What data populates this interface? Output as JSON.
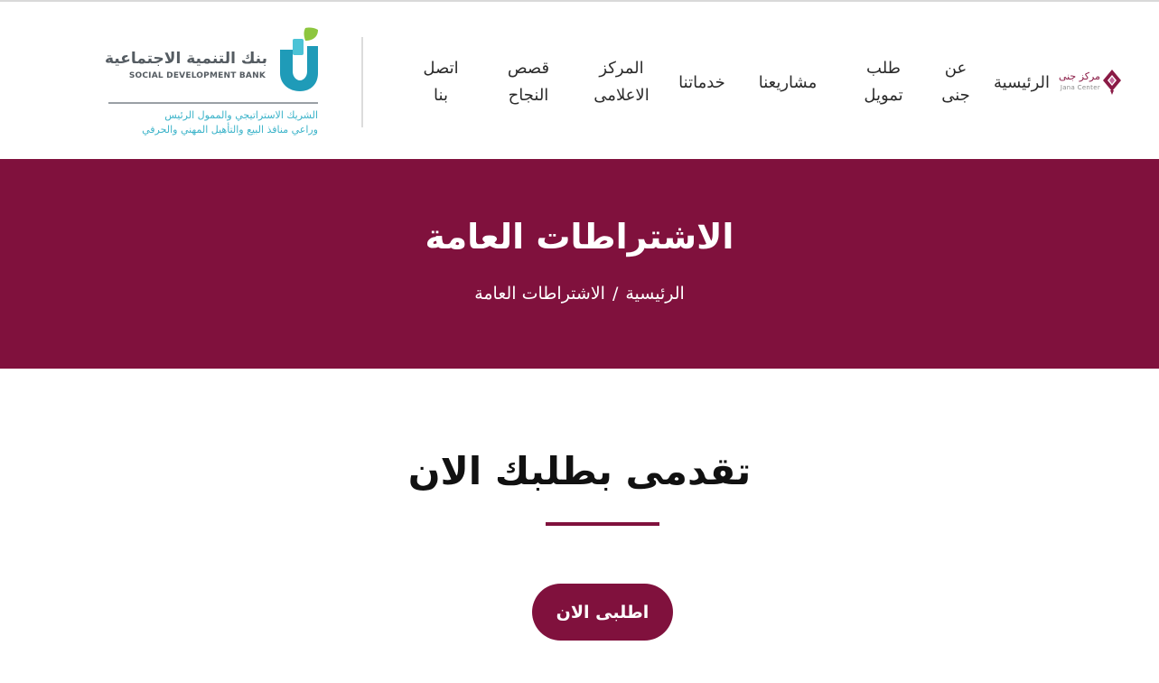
{
  "header": {
    "jana_logo": {
      "arabic": "مركز جنى",
      "english": "Jana Center",
      "icon": "jana-diamond-icon"
    },
    "nav": [
      {
        "id": "home",
        "label": "الرئيسية"
      },
      {
        "id": "about",
        "label": "عن جنى"
      },
      {
        "id": "finance",
        "label": "طلب تمويل"
      },
      {
        "id": "projects",
        "label": "مشاريعنا"
      },
      {
        "id": "services",
        "label": "خدماتنا"
      },
      {
        "id": "media",
        "label": "المركز الاعلامى"
      },
      {
        "id": "stories",
        "label": "قصص النجاح"
      },
      {
        "id": "contact",
        "label": "اتصل بنا"
      }
    ],
    "partner_logo": {
      "name_ar": "بنك التنمية الاجتماعية",
      "name_en": "SOCIAL DEVELOPMENT BANK",
      "tagline_1": "الشريك الاستراتيجي والممول الرئيس",
      "tagline_2": "وراعي منافذ البيع والتأهيل المهني والحرفي",
      "icon": "sdb-logo-icon"
    }
  },
  "hero": {
    "title": "الاشتراطات العامة",
    "breadcrumb": {
      "home": "الرئيسية",
      "separator": "/",
      "current": "الاشتراطات العامة"
    }
  },
  "main": {
    "section_title": "تقدمى بطلبك الان",
    "apply_button": "اطلبى الان"
  },
  "colors": {
    "brand": "#80113d",
    "sdb_teal": "#3bb3c9",
    "sdb_green": "#8dc63f"
  }
}
